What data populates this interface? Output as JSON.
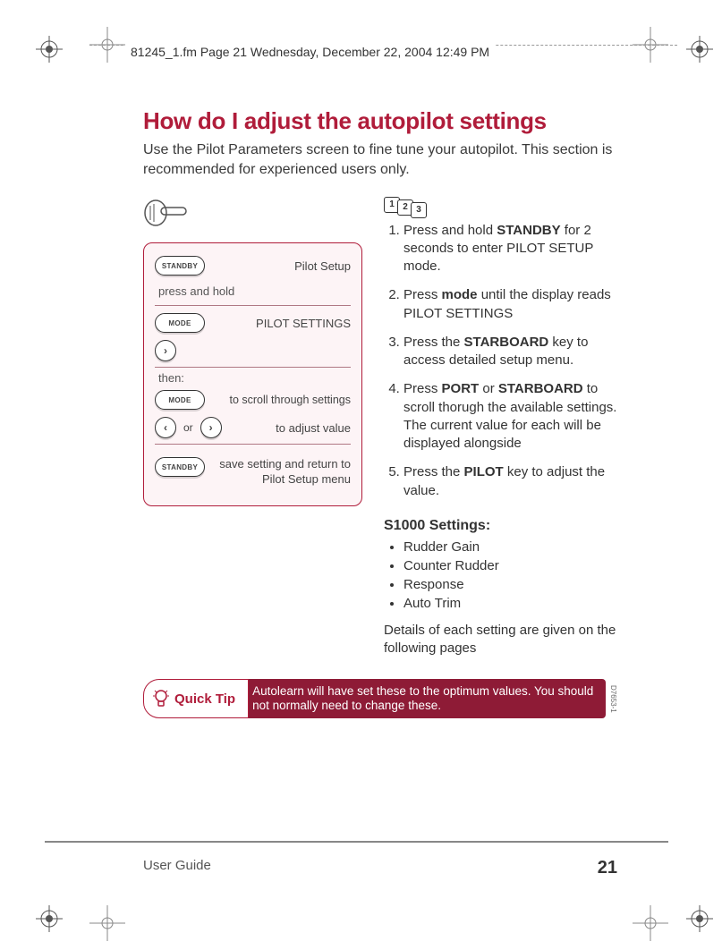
{
  "header": {
    "running": "81245_1.fm  Page 21  Wednesday, December 22, 2004  12:49 PM"
  },
  "title": "How do I adjust the autopilot settings",
  "intro": "Use the Pilot Parameters screen to fine tune your autopilot. This section is recommended for experienced users only.",
  "panel": {
    "standby_btn": "STANDBY",
    "mode_btn": "MODE",
    "pilot_setup": "Pilot Setup",
    "press_hold": "press and hold",
    "pilot_settings": "PILOT SETTINGS",
    "then": "then:",
    "scroll": "to scroll through settings",
    "or": "or",
    "adjust": "to adjust value",
    "save": "save setting and return to Pilot Setup menu"
  },
  "steps_badge": [
    "1",
    "2",
    "3"
  ],
  "steps": [
    {
      "pre": "Press and hold ",
      "bold": "STANDBY",
      "post": " for 2 seconds to enter PILOT SETUP mode."
    },
    {
      "pre": "Press ",
      "bold": "mode",
      "post": " until the display reads PILOT SETTINGS"
    },
    {
      "pre": "Press the ",
      "bold": "STARBOARD",
      "post": " key to access detailed setup menu."
    },
    {
      "pre": "Press ",
      "bold": "PORT",
      "mid": " or ",
      "bold2": "STARBOARD",
      "post": " to scroll thorugh the available settings. The current value for each will be displayed alongside"
    },
    {
      "pre": "Press the ",
      "bold": "PILOT",
      "post": " key to adjust the value."
    }
  ],
  "settings_head": "S1000 Settings:",
  "settings": [
    "Rudder Gain",
    "Counter Rudder",
    "Response",
    "Auto Trim"
  ],
  "settings_note": "Details of each setting are given on the following pages",
  "tip": {
    "label": "Quick Tip",
    "body": "Autolearn will have set these to the optimum values. You should not normally need to change these.",
    "code": "D7653-1"
  },
  "footer": {
    "left": "User Guide",
    "page": "21"
  }
}
